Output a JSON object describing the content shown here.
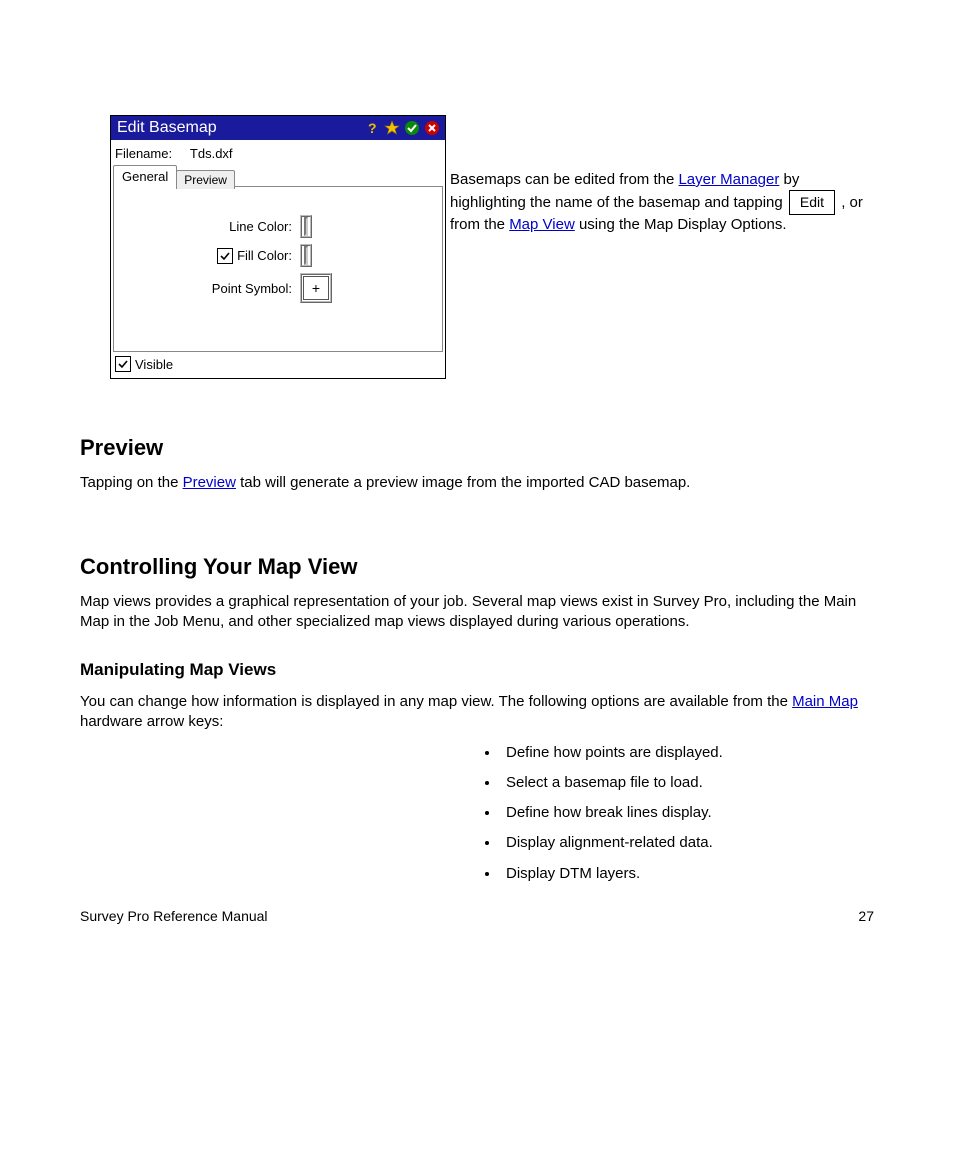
{
  "dialog": {
    "title": "Edit Basemap",
    "filename_label": "Filename:",
    "filename_value": "Tds.dxf",
    "tabs": {
      "general": "General",
      "preview": "Preview"
    },
    "fields": {
      "line_color_label": "Line Color:",
      "fill_color_label": "Fill Color:",
      "point_symbol_label": "Point Symbol:",
      "point_symbol_value": "+"
    },
    "visible_label": "Visible",
    "icons": {
      "help": "help-icon",
      "star": "star-icon",
      "ok": "ok-icon",
      "close": "close-icon"
    }
  },
  "lead": {
    "text_before_link": "Basemaps can be edited from the ",
    "link1": "Layer Manager",
    "text_mid1": " by highlighting the name of the basemap and tapping ",
    "edit_button": "Edit",
    "text_mid2": ", or from the ",
    "link2": "Map View",
    "text_after": " using the Map Display Options."
  },
  "sections": {
    "s1_title": "Preview",
    "s1_para_before": "Tapping on the ",
    "s1_preview_word": "Preview",
    "s1_para_after": " tab will generate a preview image from the imported CAD basemap.",
    "s2_title": "Controlling Your Map View",
    "s2_para": "Map views provides a graphical representation of your job. Several map views exist in Survey Pro, including the Main Map in the Job Menu, and other specialized map views displayed during various operations.",
    "s3_title": "Manipulating Map Views",
    "s3_para": "You can change how information is displayed in any map view. The following options are available from the ",
    "s3_link": "Main Map",
    "s3_para_after": " hardware arrow keys:",
    "bullets": [
      "Define how points are displayed.",
      "Select a basemap file to load.",
      "Define how break lines display.",
      "Display alignment-related data.",
      "Display DTM layers."
    ]
  },
  "footer": {
    "left": "Survey Pro Reference Manual",
    "right": "27"
  }
}
